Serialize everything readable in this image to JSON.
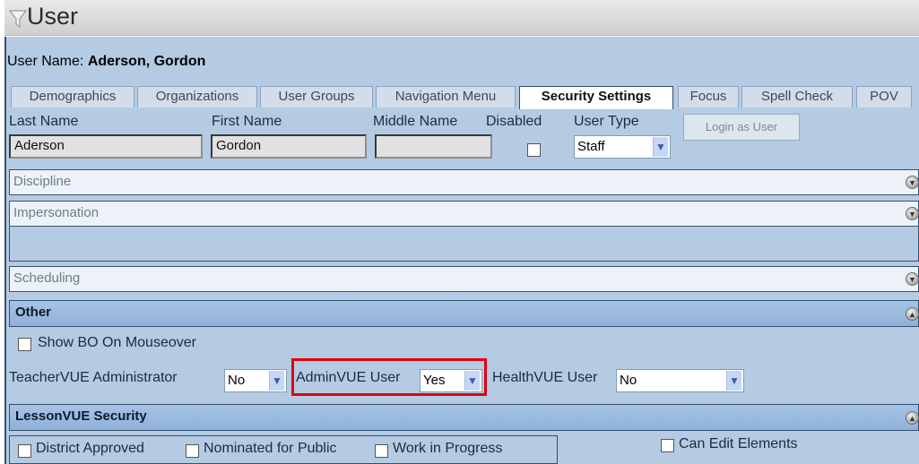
{
  "window": {
    "title": "User"
  },
  "user": {
    "name_label": "User Name:",
    "name_value": "Aderson, Gordon"
  },
  "tabs": [
    {
      "label": "Demographics",
      "active": false
    },
    {
      "label": "Organizations",
      "active": false
    },
    {
      "label": "User Groups",
      "active": false
    },
    {
      "label": "Navigation Menu",
      "active": false
    },
    {
      "label": "Security Settings",
      "active": true
    },
    {
      "label": "Focus",
      "active": false
    },
    {
      "label": "Spell Check",
      "active": false
    },
    {
      "label": "POV",
      "active": false
    }
  ],
  "fields": {
    "last_name": {
      "label": "Last Name",
      "value": "Aderson"
    },
    "first_name": {
      "label": "First Name",
      "value": "Gordon"
    },
    "middle_name": {
      "label": "Middle Name",
      "value": ""
    },
    "disabled": {
      "label": "Disabled",
      "checked": false
    },
    "user_type": {
      "label": "User Type",
      "value": "Staff"
    },
    "login_button": "Login as User"
  },
  "sections": {
    "discipline": "Discipline",
    "impersonation": "Impersonation",
    "scheduling": "Scheduling",
    "other": "Other",
    "lessonvue": "LessonVUE Security"
  },
  "other": {
    "show_bo": {
      "label": "Show BO On Mouseover",
      "checked": false
    },
    "teachervue": {
      "label": "TeacherVUE Administrator",
      "value": "No"
    },
    "adminvue": {
      "label": "AdminVUE User",
      "value": "Yes"
    },
    "healthvue": {
      "label": "HealthVUE User",
      "value": "No"
    }
  },
  "lessonvue": {
    "district_approved": "District Approved",
    "nominated": "Nominated for Public",
    "work_in_progress": "Work in Progress",
    "can_edit": "Can Edit Elements"
  },
  "colors": {
    "accent": "#35506d",
    "highlight": "#e0000e",
    "panel": "#b5cbe3"
  }
}
